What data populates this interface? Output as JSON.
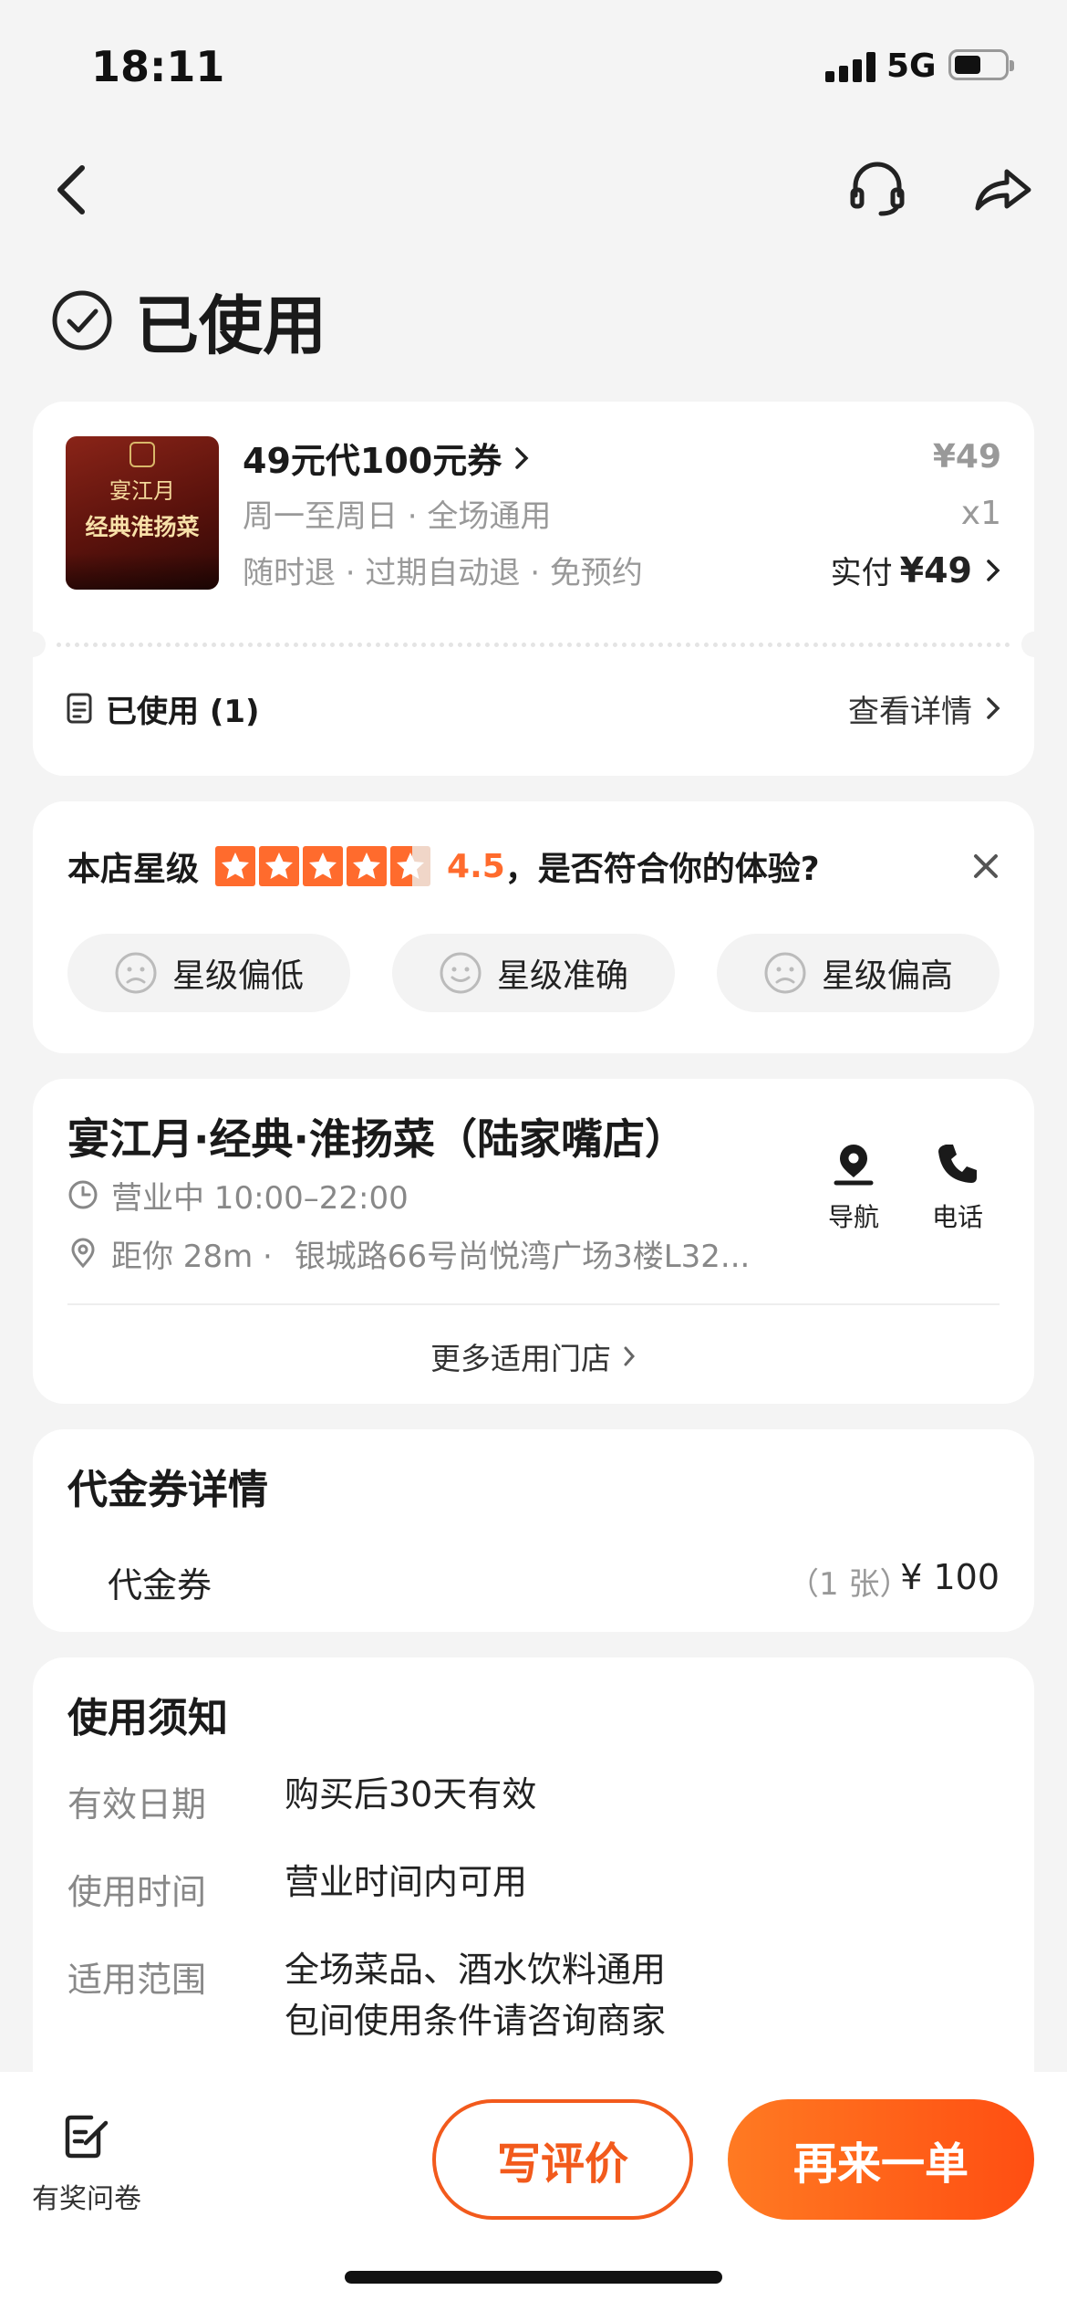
{
  "status_bar": {
    "time": "18:11",
    "network": "5G",
    "battery_level": 0.45
  },
  "page": {
    "status_title": "已使用"
  },
  "order": {
    "thumb_line1": "宴江月",
    "thumb_line2": "经典淮扬菜",
    "product_name": "49元代100元券",
    "valid_days": "周一至周日 · 全场通用",
    "refund_terms": "随时退 · 过期自动退 · 免预约",
    "unit_price": "¥49",
    "quantity": "x1",
    "paid_label": "实付",
    "paid_amount": "¥49",
    "used_label": "已使用 (1)",
    "view_details": "查看详情"
  },
  "rating": {
    "prefix": "本店星级",
    "stars": 4.5,
    "score": "4.5",
    "question": "，是否符合你的体验?",
    "options": [
      "星级偏低",
      "星级准确",
      "星级偏高"
    ]
  },
  "shop": {
    "name": "宴江月·经典·淮扬菜（陆家嘴店）",
    "hours": "营业中 10:00–22:00",
    "distance": "距你 28m ·",
    "address": "银城路66号尚悦湾广场3楼L32...",
    "nav_label": "导航",
    "phone_label": "电话",
    "more_stores": "更多适用门店"
  },
  "voucher_detail": {
    "title": "代金券详情",
    "item_name": "代金券",
    "item_count": "（1 张）",
    "item_price": "¥ 100"
  },
  "notice": {
    "title": "使用须知",
    "rows": [
      {
        "label": "有效日期",
        "value": "购买后30天有效"
      },
      {
        "label": "使用时间",
        "value": "营业时间内可用"
      },
      {
        "label": "适用范围",
        "value": "全场菜品、酒水饮料通用",
        "value2": "包间使用条件请咨询商家"
      }
    ]
  },
  "bottom": {
    "survey_label": "有奖问卷",
    "review_button": "写评价",
    "reorder_button": "再来一单"
  },
  "colors": {
    "accent": "#ff5a1a",
    "star": "#ff6b2d",
    "background": "#f4f4f4"
  }
}
